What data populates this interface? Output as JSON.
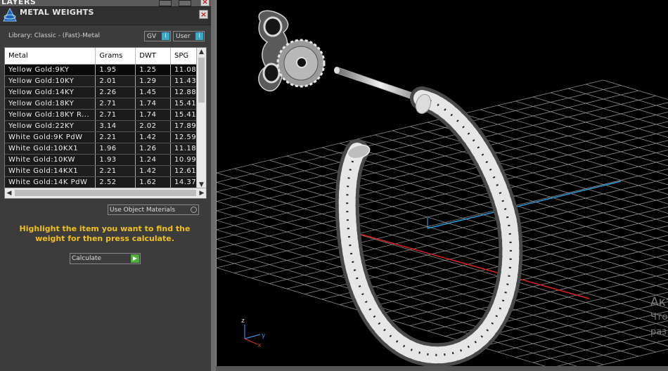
{
  "layers_panel": {
    "title": "LAYERS"
  },
  "metal_weights": {
    "title": "METAL WEIGHTS",
    "library": "Library: Classic - (Fast)-Metal",
    "toggles": [
      {
        "label": "GV",
        "icon": "info-checkbox-icon"
      },
      {
        "label": "User",
        "icon": "info-checkbox-icon"
      }
    ],
    "table": {
      "columns": [
        "Metal",
        "Grams",
        "DWT",
        "SPG"
      ],
      "rows": [
        [
          "Yellow Gold:9KY",
          "1.95",
          "1.25",
          "11.08"
        ],
        [
          "Yellow Gold:10KY",
          "2.01",
          "1.29",
          "11.43"
        ],
        [
          "Yellow Gold:14KY",
          "2.26",
          "1.45",
          "12.88"
        ],
        [
          "Yellow Gold:18KY",
          "2.71",
          "1.74",
          "15.41"
        ],
        [
          "Yellow Gold:18KY R...",
          "2.71",
          "1.74",
          "15.41"
        ],
        [
          "Yellow Gold:22KY",
          "3.14",
          "2.02",
          "17.89"
        ],
        [
          "White Gold:9K PdW",
          "2.21",
          "1.42",
          "12.59"
        ],
        [
          "White Gold:10KX1",
          "1.96",
          "1.26",
          "11.18"
        ],
        [
          "White Gold:10KW",
          "1.93",
          "1.24",
          "10.99"
        ],
        [
          "White Gold:14KX1",
          "2.21",
          "1.42",
          "12.61"
        ],
        [
          "White Gold:14K PdW",
          "2.52",
          "1.62",
          "14.37"
        ]
      ]
    },
    "use_object_materials": "Use Object Materials",
    "hint": "Highlight the item you want to find the weight for then press calculate.",
    "calculate_label": "Calculate"
  },
  "viewport": {
    "axis_labels": {
      "z": "z",
      "y": "y",
      "x": "x"
    },
    "watermark": [
      "Акт",
      "Что",
      "раз"
    ]
  },
  "colors": {
    "panel": "#3c3c3c",
    "hint": "#f0c020",
    "accent": "#3fa7c6",
    "go": "#4caf3a",
    "x_axis": "#e02020",
    "y_axis": "#2a9ad8",
    "grid": "#8a8a8a"
  }
}
